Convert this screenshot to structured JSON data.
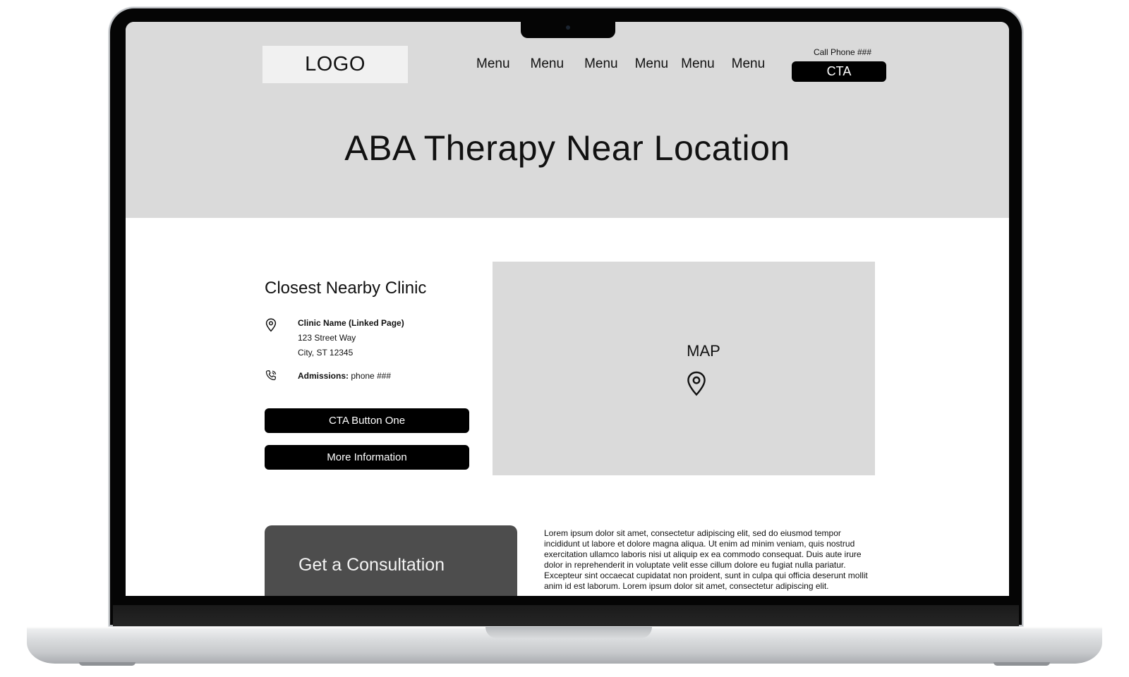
{
  "header": {
    "logo_text": "LOGO",
    "menu_items": [
      "Menu",
      "Menu",
      "Menu",
      "Menu",
      "Menu",
      "Menu"
    ],
    "call_text": "Call Phone ###",
    "cta_label": "CTA"
  },
  "hero": {
    "title": "ABA Therapy Near Location"
  },
  "clinic": {
    "heading": "Closest Nearby Clinic",
    "name": "Clinic Name (Linked Page)",
    "street": "123 Street Way",
    "city": "City, ST 12345",
    "admissions_label": "Admissions:",
    "admissions_value": "phone ###",
    "button_one": "CTA Button One",
    "button_two": "More Information"
  },
  "map": {
    "label": "MAP"
  },
  "consultation": {
    "title": "Get a Consultation"
  },
  "body_text": "Lorem ipsum dolor sit amet, consectetur adipiscing elit, sed do eiusmod tempor incididunt ut labore et dolore magna aliqua. Ut enim ad minim veniam, quis nostrud exercitation ullamco laboris nisi ut aliquip ex ea commodo consequat. Duis aute irure dolor in reprehenderit in voluptate velit esse cillum dolore eu fugiat nulla pariatur. Excepteur sint occaecat cupidatat non proident, sunt in culpa qui officia deserunt mollit anim id est laborum. Lorem ipsum dolor sit amet, consectetur adipiscing elit.",
  "colors": {
    "hero_bg": "#dadada",
    "button_bg": "#000000",
    "consult_bg": "#4d4d4d"
  }
}
